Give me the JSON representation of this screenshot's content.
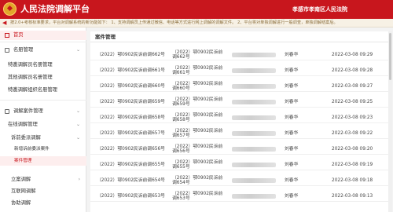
{
  "header": {
    "title": "人民法院调解平台",
    "court_name": "孝感市孝南区人民法院"
  },
  "notice": {
    "icon": "speaker-icon",
    "text": "按2.0+考核标准要求，平台对调解系统的新功能如下： 1、支持调解员上传通过微信、电话等方式进行网上调解的调解文件。 2、平台将对单独调解进行一般调查，单独调解结案后。"
  },
  "sidebar": {
    "home": "首页",
    "groups": [
      {
        "label": "名册管理",
        "items": [
          "特邀调解员名册管理",
          "其他调解员名册管理",
          "特邀调解组织名册管理"
        ]
      },
      {
        "label": "调解案件管理",
        "items": [
          "在线调解管理",
          "诉前委派调解",
          "新增诉前委派案件",
          "案件管理",
          "立案调解",
          "互联网调解",
          "协助调解"
        ]
      }
    ]
  },
  "main": {
    "panel_title": "案件管理",
    "rows": [
      {
        "case_no": "（2022）鄂0902民诉前调662号",
        "linked_top": "（2022）鄂0902民诉前",
        "linked_bottom": "调662号",
        "person": "刘春华",
        "date": "2022-03-08 09:29"
      },
      {
        "case_no": "（2022）鄂0902民诉前调661号",
        "linked_top": "（2022）鄂0902民诉前",
        "linked_bottom": "调661号",
        "person": "刘春华",
        "date": "2022-03-08 09:28"
      },
      {
        "case_no": "（2022）鄂0902民诉前调660号",
        "linked_top": "（2022）鄂0902民诉前",
        "linked_bottom": "调660号",
        "person": "刘春华",
        "date": "2022-03-08 09:27"
      },
      {
        "case_no": "（2022）鄂0902民诉前调659号",
        "linked_top": "（2022）鄂0902民诉前",
        "linked_bottom": "调659号",
        "person": "刘春华",
        "date": "2022-03-08 09:25"
      },
      {
        "case_no": "（2022）鄂0902民诉前调658号",
        "linked_top": "（2022）鄂0902民诉前",
        "linked_bottom": "调658号",
        "person": "刘春华",
        "date": "2022-03-08 09:23"
      },
      {
        "case_no": "（2022）鄂0902民诉前调657号",
        "linked_top": "（2022）鄂0902民诉前",
        "linked_bottom": "调657号",
        "person": "刘春华",
        "date": "2022-03-08 09:22"
      },
      {
        "case_no": "（2022）鄂0902民诉前调656号",
        "linked_top": "（2022）鄂0902民诉前",
        "linked_bottom": "调656号",
        "person": "刘春华",
        "date": "2022-03-08 09:20"
      },
      {
        "case_no": "（2022）鄂0902民诉前调655号",
        "linked_top": "（2022）鄂0902民诉前",
        "linked_bottom": "调655号",
        "person": "刘春华",
        "date": "2022-03-08 09:19"
      },
      {
        "case_no": "（2022）鄂0902民诉前调654号",
        "linked_top": "（2022）鄂0902民诉前",
        "linked_bottom": "调654号",
        "person": "刘春华",
        "date": "2022-03-08 09:18"
      },
      {
        "case_no": "（2022）鄂0902民诉前调653号",
        "linked_top": "（2022）鄂0902民诉前",
        "linked_bottom": "调653号",
        "person": "刘春华",
        "date": "2022-03-08 09:13"
      }
    ]
  },
  "colors": {
    "brand_red": "#c8161d",
    "active_bg": "#fdeeee"
  }
}
